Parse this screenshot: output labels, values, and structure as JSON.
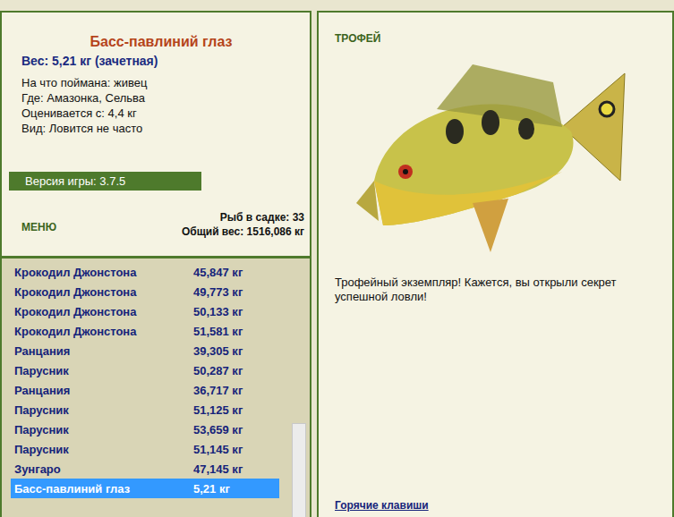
{
  "fish": {
    "name": "Басс-павлиний глаз",
    "weight": "Вес: 5,21 кг (зачетная)",
    "details": [
      "На что поймана: живец",
      "Где: Амазонка, Сельва",
      "Оценивается с: 4,4 кг",
      "Вид: Ловится не часто"
    ]
  },
  "version": "Версия игры: 3.7.5",
  "menu": "МЕНЮ",
  "stats": [
    "Рыб в садке: 33",
    "Общий вес: 1516,086 кг"
  ],
  "catch_list": {
    "rows": [
      {
        "name": "Крокодил Джонстона",
        "weight": "45,847 кг",
        "selected": false
      },
      {
        "name": "Крокодил Джонстона",
        "weight": "49,773 кг",
        "selected": false
      },
      {
        "name": "Крокодил Джонстона",
        "weight": "50,133 кг",
        "selected": false
      },
      {
        "name": "Крокодил Джонстона",
        "weight": "51,581 кг",
        "selected": false
      },
      {
        "name": "Ранцания",
        "weight": "39,305 кг",
        "selected": false
      },
      {
        "name": "Парусник",
        "weight": "50,287 кг",
        "selected": false
      },
      {
        "name": "Ранцания",
        "weight": "36,717 кг",
        "selected": false
      },
      {
        "name": "Парусник",
        "weight": "51,125 кг",
        "selected": false
      },
      {
        "name": "Парусник",
        "weight": "53,659 кг",
        "selected": false
      },
      {
        "name": "Парусник",
        "weight": "51,145 кг",
        "selected": false
      },
      {
        "name": "Зунгаро",
        "weight": "47,145 кг",
        "selected": false
      },
      {
        "name": "Басс-павлиний глаз",
        "weight": "5,21 кг",
        "selected": true
      }
    ],
    "scroll_level": 0.95
  },
  "trophy": {
    "badge": "ТРОФЕЙ",
    "message": "Трофейный экземпляр! Кажется, вы открыли секрет успешной ловли!"
  },
  "hotkeys": "Горячие клавиши"
}
